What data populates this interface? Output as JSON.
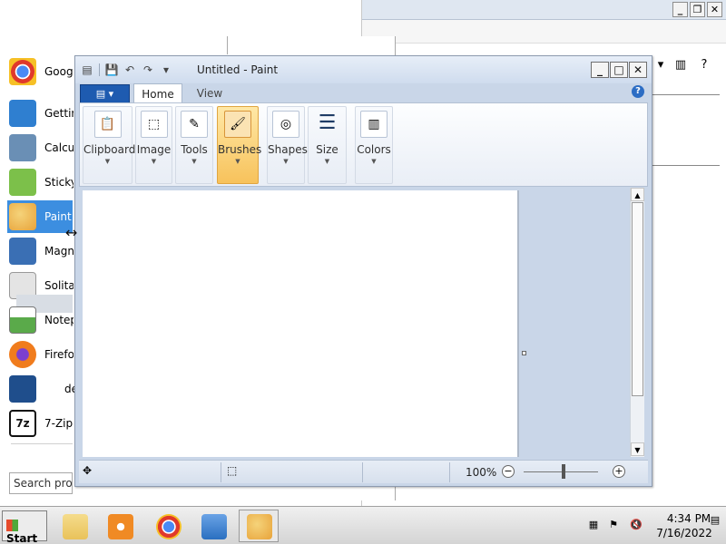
{
  "background_window": {
    "controls": [
      "_",
      "❐",
      "✕"
    ]
  },
  "start_menu": {
    "programs": [
      {
        "label": "Goog",
        "icon": "chrome-icon",
        "color": "#e0392b"
      },
      {
        "label": "Gettir",
        "icon": "getting-started-icon",
        "color": "#2f7fd0"
      },
      {
        "label": "Calcu",
        "icon": "calculator-icon",
        "color": "#6a8fb5"
      },
      {
        "label": "Sticky",
        "icon": "sticky-notes-icon",
        "color": "#7cc04a"
      },
      {
        "label": "Paint",
        "icon": "paint-icon",
        "color": "#e8a33a"
      },
      {
        "label": "Magn",
        "icon": "magnifier-icon",
        "color": "#3a6fb4"
      },
      {
        "label": "Solita",
        "icon": "solitaire-icon",
        "color": "#c8c8c8"
      },
      {
        "label": "Notep",
        "icon": "notepad-icon",
        "color": "#5aaa4a"
      },
      {
        "label": "Firefo",
        "icon": "firefox-icon",
        "color": "#f07c1d"
      },
      {
        "label": "de",
        "icon": "powershell-icon",
        "color": "#1f4e8c"
      },
      {
        "label": "7-Zip",
        "icon": "7zip-icon",
        "color": "#111111"
      }
    ],
    "search_placeholder": "Search prog"
  },
  "paint": {
    "title": "Untitled - Paint",
    "qat": [
      "▤",
      "💾",
      "↶",
      "↷",
      "▾"
    ],
    "controls": {
      "minimize": "_",
      "maximize": "□",
      "close": "✕"
    },
    "file_menu": "▤ ▾",
    "tabs": {
      "home": "Home",
      "view": "View"
    },
    "help": "?",
    "groups": [
      {
        "label": "Clipboard",
        "icon": "📋"
      },
      {
        "label": "Image",
        "icon": "⬚"
      },
      {
        "label": "Tools",
        "icon": "✎"
      },
      {
        "label": "Brushes",
        "icon": "🖌"
      },
      {
        "label": "Shapes",
        "icon": "◎"
      },
      {
        "label": "Size",
        "icon": "☰"
      },
      {
        "label": "Colors",
        "icon": "▥"
      }
    ],
    "dropdown_arrow": "▼",
    "status": {
      "position_icon": "✥",
      "selection_icon": "⬚",
      "zoom": "100%",
      "zoom_out": "−",
      "zoom_in": "+"
    }
  },
  "taskbar": {
    "start_label": "Start",
    "apps": [
      {
        "icon": "file-explorer-icon",
        "color": "#e9c25a"
      },
      {
        "icon": "media-player-icon",
        "color": "#f08a24"
      },
      {
        "icon": "chrome-icon",
        "color": "#e0392b"
      },
      {
        "icon": "remote-desktop-icon",
        "color": "#2a6fc0"
      },
      {
        "icon": "paint-icon",
        "color": "#e8a33a"
      }
    ],
    "clock_time": "4:34 PM",
    "clock_date": "7/16/2022"
  }
}
